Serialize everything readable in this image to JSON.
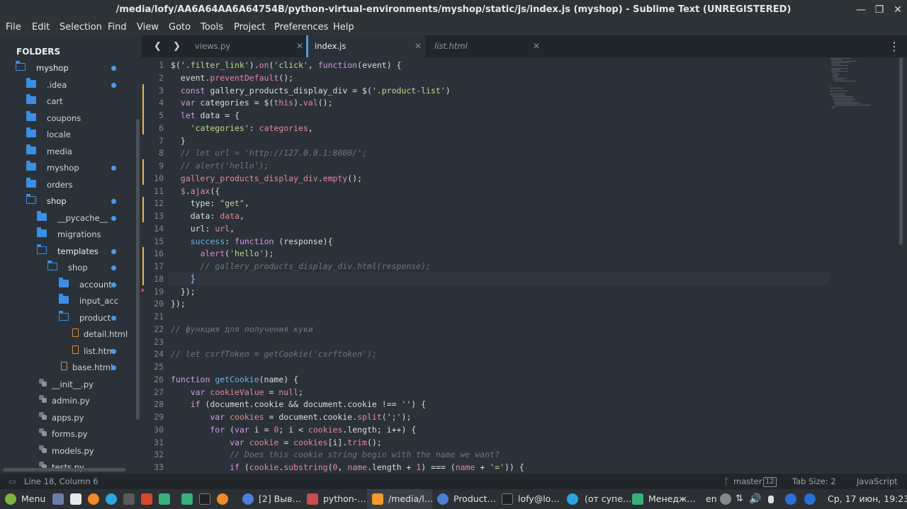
{
  "window": {
    "title": "/media/lofy/AA6A64AA6A64754B/python-virtual-environments/myshop/static/js/index.js (myshop) - Sublime Text (UNREGISTERED)",
    "minimize": "—",
    "maximize": "❐",
    "close": "✕"
  },
  "menu": [
    "File",
    "Edit",
    "Selection",
    "Find",
    "View",
    "Goto",
    "Tools",
    "Project",
    "Preferences",
    "Help"
  ],
  "sidebar": {
    "header": "FOLDERS",
    "items": [
      {
        "label": "myshop",
        "type": "folder-open",
        "dot": true
      },
      {
        "label": ".idea",
        "type": "folder",
        "dot": true
      },
      {
        "label": "cart",
        "type": "folder",
        "dot": false
      },
      {
        "label": "coupons",
        "type": "folder",
        "dot": false
      },
      {
        "label": "locale",
        "type": "folder",
        "dot": false
      },
      {
        "label": "media",
        "type": "folder",
        "dot": false
      },
      {
        "label": "myshop",
        "type": "folder",
        "dot": true
      },
      {
        "label": "orders",
        "type": "folder",
        "dot": false
      },
      {
        "label": "shop",
        "type": "folder-open",
        "dot": true
      },
      {
        "label": "__pycache__",
        "type": "folder",
        "dot": true
      },
      {
        "label": "migrations",
        "type": "folder",
        "dot": false
      },
      {
        "label": "templates",
        "type": "folder-open",
        "dot": true
      },
      {
        "label": "shop",
        "type": "folder-open",
        "dot": true
      },
      {
        "label": "account",
        "type": "folder",
        "dot": true
      },
      {
        "label": "input_acc",
        "type": "folder",
        "dot": false
      },
      {
        "label": "product",
        "type": "folder-open",
        "dot": true
      },
      {
        "label": "detail.html",
        "type": "html",
        "dot": false
      },
      {
        "label": "list.htm",
        "type": "html",
        "dot": true
      },
      {
        "label": "base.html",
        "type": "html",
        "dot": true
      },
      {
        "label": "__init__.py",
        "type": "py",
        "dot": false
      },
      {
        "label": "admin.py",
        "type": "py",
        "dot": false
      },
      {
        "label": "apps.py",
        "type": "py",
        "dot": false
      },
      {
        "label": "forms.py",
        "type": "py",
        "dot": false
      },
      {
        "label": "models.py",
        "type": "py",
        "dot": false
      },
      {
        "label": "tests.py",
        "type": "py",
        "dot": false
      }
    ]
  },
  "tabs": {
    "back": "❮",
    "forward": "❯",
    "items": [
      {
        "label": "views.py",
        "close": "✕"
      },
      {
        "label": "index.js",
        "close": "✕"
      },
      {
        "label": "list.html",
        "close": "✕"
      }
    ],
    "more": "⋮"
  },
  "editor": {
    "language": "JavaScript",
    "lines": [
      [
        [
          "pl",
          "$("
        ],
        [
          "str",
          "'.filter_link'"
        ],
        [
          "pl",
          ")."
        ],
        [
          "fn",
          "on"
        ],
        [
          "pl",
          "("
        ],
        [
          "str",
          "'click'"
        ],
        [
          "pl",
          ", "
        ],
        [
          "kw",
          "function"
        ],
        [
          "pl",
          "(event) {"
        ]
      ],
      [
        [
          "pl",
          "  event."
        ],
        [
          "fn",
          "preventDefault"
        ],
        [
          "pl",
          "();"
        ]
      ],
      [
        [
          "kw",
          "  const "
        ],
        [
          "pl",
          "gallery_products_display_div = $("
        ],
        [
          "str",
          "'.product-list'"
        ],
        [
          "pl",
          ")"
        ]
      ],
      [
        [
          "kw",
          "  var "
        ],
        [
          "pl",
          "categories = $("
        ],
        [
          "pr",
          "this"
        ],
        [
          "pl",
          ")."
        ],
        [
          "fn",
          "val"
        ],
        [
          "pl",
          "();"
        ]
      ],
      [
        [
          "kw",
          "  let "
        ],
        [
          "pl",
          "data = {"
        ]
      ],
      [
        [
          "str",
          "    'categories'"
        ],
        [
          "pl",
          ": "
        ],
        [
          "pr",
          "categories"
        ],
        [
          "pl",
          ","
        ]
      ],
      [
        [
          "pl",
          "  }"
        ]
      ],
      [
        [
          "cm",
          "  // let url = 'http://127.0.0.1:8000/';"
        ]
      ],
      [
        [
          "cm",
          "  // alert('hello');"
        ]
      ],
      [
        [
          "pr",
          "  gallery_products_display_div"
        ],
        [
          "pl",
          "."
        ],
        [
          "fn",
          "empty"
        ],
        [
          "pl",
          "();"
        ]
      ],
      [
        [
          "pr",
          "  $"
        ],
        [
          "pl",
          "."
        ],
        [
          "fn",
          "ajax"
        ],
        [
          "pl",
          "({"
        ]
      ],
      [
        [
          "pl",
          "    type: "
        ],
        [
          "str",
          "\"get\""
        ],
        [
          "pl",
          ","
        ]
      ],
      [
        [
          "pl",
          "    data: "
        ],
        [
          "pr",
          "data"
        ],
        [
          "pl",
          ","
        ]
      ],
      [
        [
          "pl",
          "    url: "
        ],
        [
          "pr",
          "url"
        ],
        [
          "pl",
          ","
        ]
      ],
      [
        [
          "ln2",
          "    success"
        ],
        [
          "pl",
          ": "
        ],
        [
          "kw",
          "function"
        ],
        [
          "pl",
          " (response){"
        ]
      ],
      [
        [
          "fn",
          "      alert"
        ],
        [
          "pl",
          "("
        ],
        [
          "str",
          "'hello'"
        ],
        [
          "pl",
          ");"
        ]
      ],
      [
        [
          "cm",
          "      // gallery_products_display_div.html(response);"
        ]
      ],
      [
        [
          "pl",
          "    }"
        ]
      ],
      [
        [
          "pl",
          "  });"
        ]
      ],
      [
        [
          "pl",
          "});"
        ]
      ],
      [
        [
          "pl",
          ""
        ]
      ],
      [
        [
          "cm",
          "// функция для получения куки"
        ]
      ],
      [
        [
          "pl",
          ""
        ]
      ],
      [
        [
          "cm",
          "// let csrfToken = getCookie('csrftoken');"
        ]
      ],
      [
        [
          "pl",
          ""
        ]
      ],
      [
        [
          "kw",
          "function "
        ],
        [
          "ln2",
          "getCookie"
        ],
        [
          "pl",
          "(name) {"
        ]
      ],
      [
        [
          "kw",
          "    var "
        ],
        [
          "pr",
          "cookieValue"
        ],
        [
          "pl",
          " = "
        ],
        [
          "pr",
          "null"
        ],
        [
          "pl",
          ";"
        ]
      ],
      [
        [
          "kw",
          "    if "
        ],
        [
          "pl",
          "(document.cookie && document.cookie !== "
        ],
        [
          "str",
          "''"
        ],
        [
          "pl",
          ") {"
        ]
      ],
      [
        [
          "kw",
          "        var "
        ],
        [
          "pr",
          "cookies"
        ],
        [
          "pl",
          " = document.cookie."
        ],
        [
          "fn",
          "split"
        ],
        [
          "pl",
          "("
        ],
        [
          "str",
          "';'"
        ],
        [
          "pl",
          ");"
        ]
      ],
      [
        [
          "kw",
          "        for "
        ],
        [
          "pl",
          "("
        ],
        [
          "kw",
          "var "
        ],
        [
          "pl",
          "i = "
        ],
        [
          "pr",
          "0"
        ],
        [
          "pl",
          "; i < "
        ],
        [
          "pr",
          "cookies"
        ],
        [
          "pl",
          ".length; i++) {"
        ]
      ],
      [
        [
          "kw",
          "            var "
        ],
        [
          "pr",
          "cookie"
        ],
        [
          "pl",
          " = "
        ],
        [
          "pr",
          "cookies"
        ],
        [
          "pl",
          "[i]."
        ],
        [
          "fn",
          "trim"
        ],
        [
          "pl",
          "();"
        ]
      ],
      [
        [
          "cm",
          "            // Does this cookie string begin with the name we want?"
        ]
      ],
      [
        [
          "kw",
          "            if "
        ],
        [
          "pl",
          "("
        ],
        [
          "pr",
          "cookie"
        ],
        [
          "pl",
          "."
        ],
        [
          "fn",
          "substring"
        ],
        [
          "pl",
          "("
        ],
        [
          "pr",
          "0"
        ],
        [
          "pl",
          ", "
        ],
        [
          "pr",
          "name"
        ],
        [
          "pl",
          ".length + "
        ],
        [
          "pr",
          "1"
        ],
        [
          "pl",
          ") === ("
        ],
        [
          "pr",
          "name"
        ],
        [
          "pl",
          " + "
        ],
        [
          "str",
          "'='"
        ],
        [
          "pl",
          ")) {"
        ]
      ]
    ]
  },
  "status": {
    "position": "Line 18, Column 6",
    "branch": "master",
    "branch_count": "12",
    "tab_size": "Tab Size: 2",
    "syntax": "JavaScript"
  },
  "taskbar": {
    "menu": "Menu",
    "windows": [
      "[2] Выв…",
      "python-…",
      "/media/l…",
      "Product…",
      "lofy@lo…",
      "(от супе…",
      "Менедж…"
    ],
    "lang": "en",
    "clock": "Ср, 17 июн, 19:23"
  },
  "colors": {
    "accent": "#4d9be6",
    "folder": "#3b8fe0",
    "modified_marker": "#e6b955"
  }
}
